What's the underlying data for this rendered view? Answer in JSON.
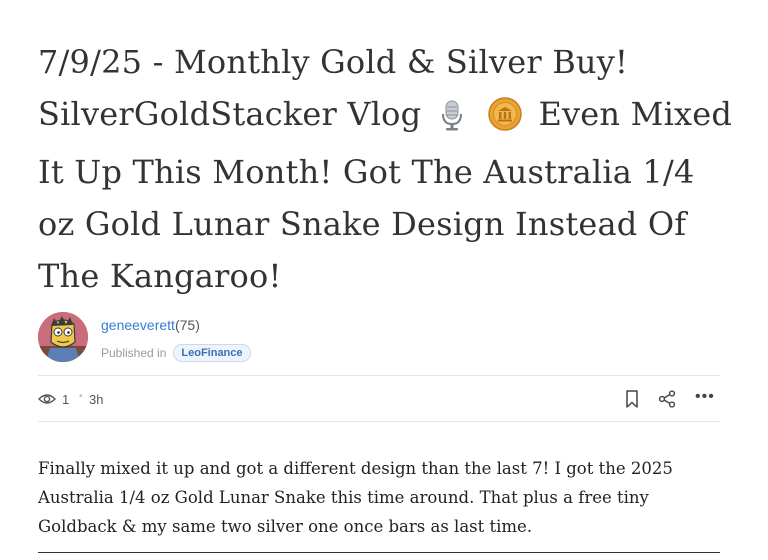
{
  "post": {
    "title_part1": "7/9/25 - Monthly Gold & Silver Buy! SilverGoldStacker Vlog",
    "title_part2": "Even Mixed It Up This Month! Got The Australia 1/4 oz Gold Lunar Snake Design Instead Of The Kangaroo!",
    "title_icons": [
      "microphone-icon",
      "coin-icon"
    ],
    "author": {
      "name": "geneeverett",
      "reputation": "(75)",
      "published_label": "Published in",
      "community": "LeoFinance"
    },
    "stats": {
      "views": "1",
      "separator": "•",
      "time_ago": "3h"
    },
    "actions": {
      "more": "•••"
    },
    "body": "Finally mixed it up and got a different design than the last 7! I got the 2025 Australia 1/4 oz Gold Lunar Snake this time around. That plus a free tiny Goldback & my same two silver one once bars as last time."
  },
  "colors": {
    "link": "#3a7bd5",
    "community_badge_bg": "#eef4fc",
    "coin_gold": "#e8a334"
  }
}
